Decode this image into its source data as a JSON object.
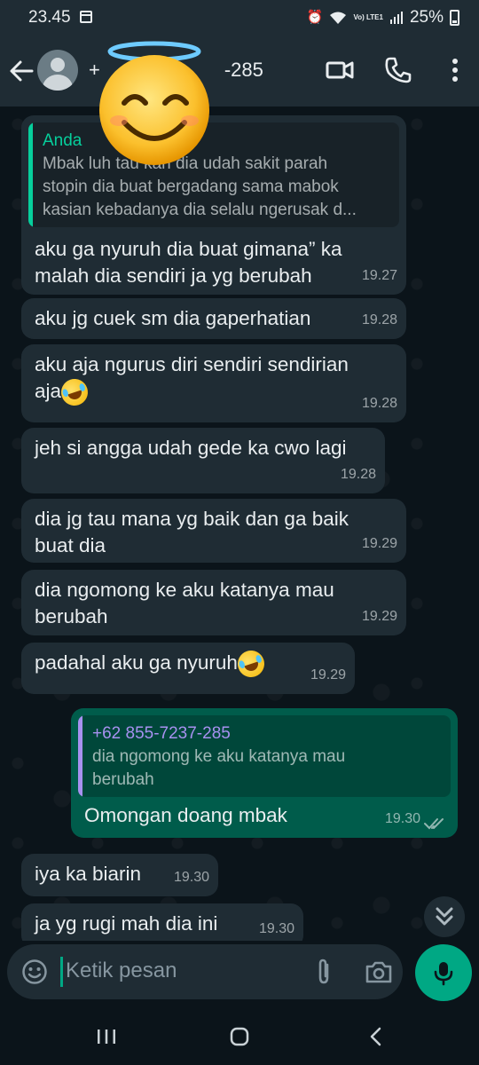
{
  "status_bar": {
    "time": "23.45",
    "battery": "25%",
    "network": "Vo) LTE1"
  },
  "header": {
    "name_prefix": "+",
    "name_suffix": "-285"
  },
  "messages": [
    {
      "dir": "in",
      "quote": {
        "author": "Anda",
        "text": "Mbak luh tau kan dia udah sakit parah\nstopin dia buat bergadang sama mabok\nkasian kebadanya dia selalu ngerusak d..."
      },
      "text": "aku ga nyuruh dia buat gimana” ka\nmalah dia sendiri ja yg berubah",
      "time": "19.27"
    },
    {
      "dir": "in",
      "text": "aku jg cuek sm dia gaperhatian",
      "time": "19.28"
    },
    {
      "dir": "in",
      "text": "aku aja ngurus diri sendiri sendirian\naja",
      "emoji": "rolling-on-floor-laughing-emoji",
      "time": "19.28"
    },
    {
      "dir": "in",
      "text": "jeh si angga udah gede ka cwo lagi",
      "time": "19.28"
    },
    {
      "dir": "in",
      "text": "dia jg tau mana yg baik dan ga baik\nbuat dia",
      "time": "19.29"
    },
    {
      "dir": "in",
      "text": "dia ngomong ke aku katanya mau\nberubah",
      "time": "19.29"
    },
    {
      "dir": "in",
      "text": "padahal aku ga nyuruh",
      "emoji": "rolling-on-floor-laughing-emoji",
      "time": "19.29"
    },
    {
      "dir": "out",
      "quote": {
        "author": "+62 855-7237-285",
        "text": "dia ngomong ke aku katanya mau\nberubah"
      },
      "text": "Omongan doang mbak",
      "time": "19.30",
      "status": "read"
    },
    {
      "dir": "in",
      "text": "iya ka biarin",
      "time": "19.30"
    },
    {
      "dir": "in",
      "text": "ja yg rugi mah dia ini",
      "time": "19.30"
    }
  ],
  "composer": {
    "placeholder": "Ketik pesan"
  },
  "colors": {
    "incoming": "#1f2c34",
    "outgoing": "#005c4b",
    "accent": "#00a884",
    "quote_self": "#06cf9c",
    "quote_contact": "#a791f0"
  }
}
